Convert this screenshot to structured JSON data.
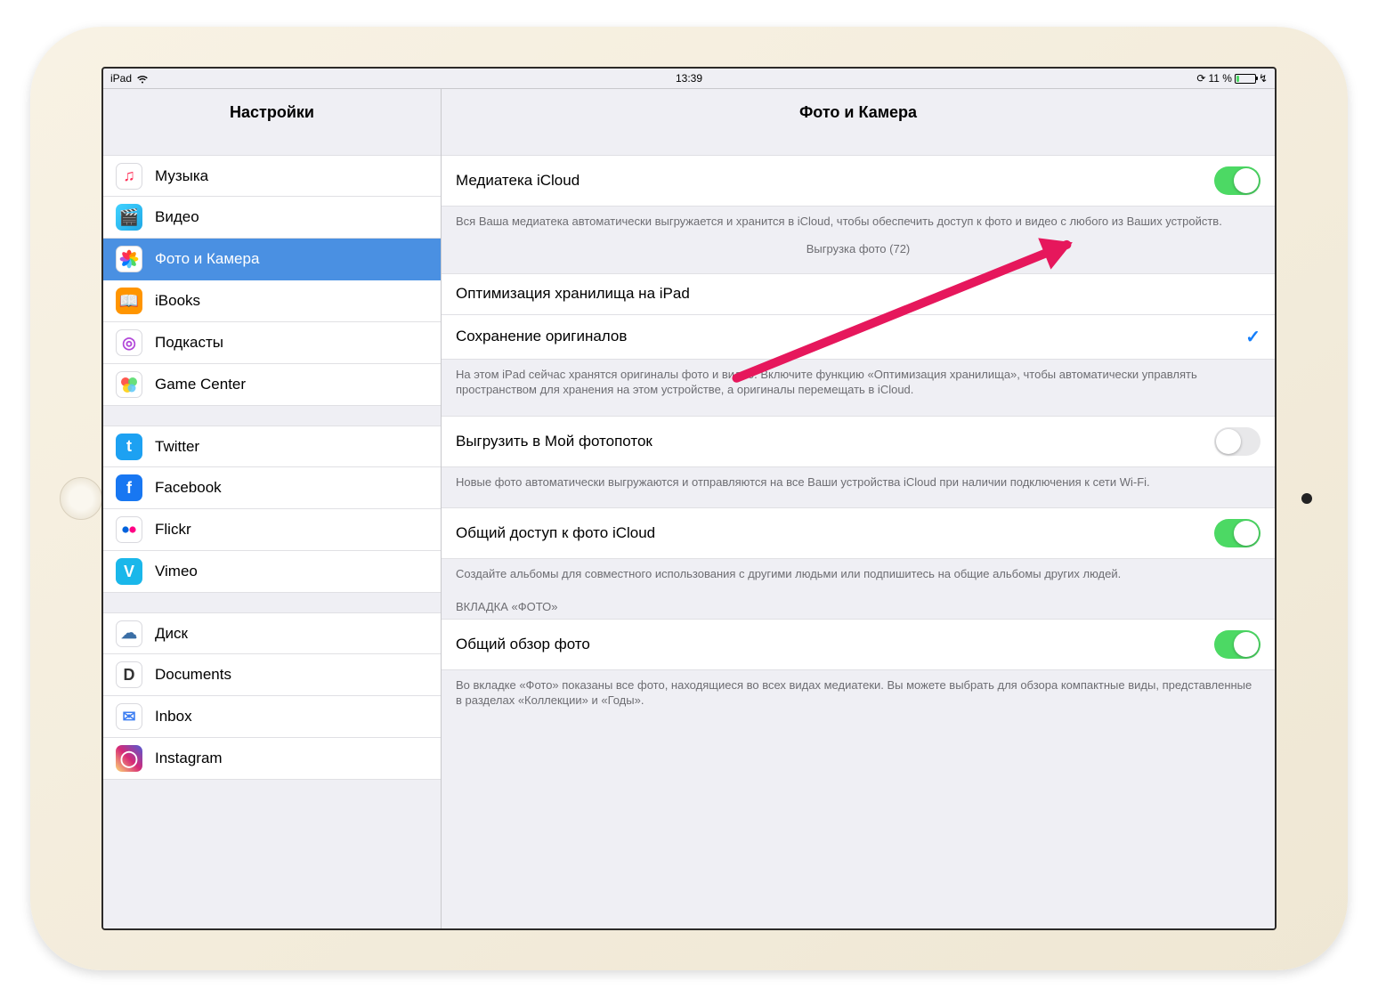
{
  "status": {
    "device": "iPad",
    "time": "13:39",
    "battery": "11 %",
    "charging": "↯"
  },
  "sidebar": {
    "title": "Настройки",
    "groups": [
      {
        "items": [
          {
            "id": "music",
            "label": "Музыка",
            "bg": "#ffffff",
            "glyph": "♫",
            "glyphColor": "#ff2d55",
            "border": true
          },
          {
            "id": "video",
            "label": "Видео",
            "bg": "linear-gradient(135deg,#41d2ff,#1fa8e6)",
            "glyph": "🎬"
          },
          {
            "id": "photos",
            "label": "Фото и Камера",
            "bg": "#ffffff",
            "glyph": "flower",
            "selected": true,
            "border": true
          },
          {
            "id": "ibooks",
            "label": "iBooks",
            "bg": "#ff9500",
            "glyph": "📖"
          },
          {
            "id": "podcasts",
            "label": "Подкасты",
            "bg": "#ffffff",
            "glyph": "◎",
            "glyphColor": "#b248d9",
            "border": true
          },
          {
            "id": "gamecenter",
            "label": "Game Center",
            "bg": "#ffffff",
            "glyph": "●●●",
            "glyphColor": "#ffcc00",
            "border": true
          }
        ]
      },
      {
        "items": [
          {
            "id": "twitter",
            "label": "Twitter",
            "bg": "#1da1f2",
            "glyph": "t"
          },
          {
            "id": "facebook",
            "label": "Facebook",
            "bg": "#1877f2",
            "glyph": "f"
          },
          {
            "id": "flickr",
            "label": "Flickr",
            "bg": "#ffffff",
            "glyph": "••",
            "border": true
          },
          {
            "id": "vimeo",
            "label": "Vimeo",
            "bg": "#1ab7ea",
            "glyph": "V"
          }
        ]
      },
      {
        "items": [
          {
            "id": "disk",
            "label": "Диск",
            "bg": "#ffffff",
            "glyph": "☁",
            "glyphColor": "#3a6ea5",
            "border": true
          },
          {
            "id": "documents",
            "label": "Documents",
            "bg": "#ffffff",
            "glyph": "D",
            "glyphColor": "#333",
            "border": true
          },
          {
            "id": "inbox",
            "label": "Inbox",
            "bg": "#ffffff",
            "glyph": "✉",
            "glyphColor": "#3e7ff2",
            "border": true
          },
          {
            "id": "instagram",
            "label": "Instagram",
            "bg": "linear-gradient(45deg,#feda75,#d62976,#4f5bd5)",
            "glyph": "◯"
          }
        ]
      }
    ]
  },
  "detail": {
    "title": "Фото и Камера",
    "sections": [
      {
        "cells": [
          {
            "kind": "toggle",
            "id": "icloud-library",
            "label": "Медиатека iCloud",
            "on": true
          }
        ],
        "footer": "Вся Ваша медиатека автоматически выгружается и хранится в iCloud, чтобы обеспечить доступ к фото и видео с любого из Ваших устройств.",
        "status": "Выгрузка фото (72)"
      },
      {
        "cells": [
          {
            "kind": "radio",
            "id": "optimize",
            "label": "Оптимизация хранилища на iPad",
            "checked": false
          },
          {
            "kind": "radio",
            "id": "originals",
            "label": "Сохранение оригиналов",
            "checked": true
          }
        ],
        "footer": "На этом iPad сейчас хранятся оригиналы фото и видео. Включите функцию «Оптимизация хранилища», чтобы автоматически управлять пространством для хранения на этом устройстве, а оригиналы перемещать в iCloud."
      },
      {
        "cells": [
          {
            "kind": "toggle",
            "id": "photostream",
            "label": "Выгрузить в Мой фотопоток",
            "on": false
          }
        ],
        "footer": "Новые фото автоматически выгружаются и отправляются на все Ваши устройства iCloud при наличии подключения к сети Wi-Fi."
      },
      {
        "cells": [
          {
            "kind": "toggle",
            "id": "shared",
            "label": "Общий доступ к фото iCloud",
            "on": true
          }
        ],
        "footer": "Создайте альбомы для совместного использования с другими людьми или подпишитесь на общие альбомы других людей."
      },
      {
        "header": "ВКЛАДКА «ФОТО»",
        "cells": [
          {
            "kind": "toggle",
            "id": "summary",
            "label": "Общий обзор фото",
            "on": true
          }
        ],
        "footer": "Во вкладке «Фото» показаны все фото, находящиеся во всех видах медиатеки. Вы можете выбрать для обзора компактные виды, представленные в разделах «Коллекции» и «Годы»."
      }
    ]
  }
}
